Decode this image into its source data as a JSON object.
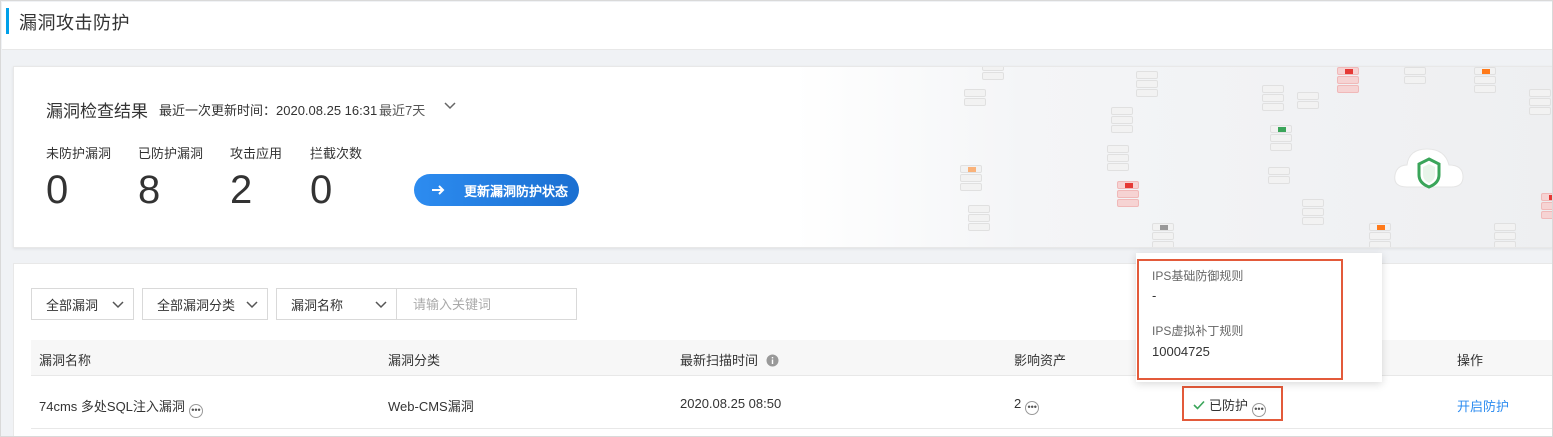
{
  "header": {
    "title": "漏洞攻击防护"
  },
  "summary": {
    "title": "漏洞检查结果",
    "updated": "最近一次更新时间：2020.08.25 16:31",
    "range": "最近7天",
    "stats": [
      {
        "label": "未防护漏洞",
        "value": "0"
      },
      {
        "label": "已防护漏洞",
        "value": "8"
      },
      {
        "label": "攻击应用",
        "value": "2"
      },
      {
        "label": "拦截次数",
        "value": "0"
      }
    ],
    "update_button": "更新漏洞防护状态"
  },
  "filters": {
    "all_vulns": "全部漏洞",
    "all_categories": "全部漏洞分类",
    "field": "漏洞名称",
    "search_placeholder": "请输入关键词"
  },
  "table": {
    "columns": [
      "漏洞名称",
      "漏洞分类",
      "最新扫描时间",
      "影响资产",
      "操作"
    ],
    "rows": [
      {
        "name": "74cms 多处SQL注入漏洞",
        "category": "Web-CMS漏洞",
        "scan_time": "2020.08.25 08:50",
        "assets": "2",
        "status": "已防护",
        "action": "开启防护"
      }
    ]
  },
  "popover": {
    "ips_rule_label": "IPS基础防御规则",
    "ips_rule_value": "-",
    "patch_label": "IPS虚拟补丁规则",
    "patch_value": "10004725"
  },
  "colors": {
    "accent": "#00a0e9",
    "primary": "#2d8cf0",
    "highlight": "#e35a3a",
    "success": "#3aa55a"
  }
}
